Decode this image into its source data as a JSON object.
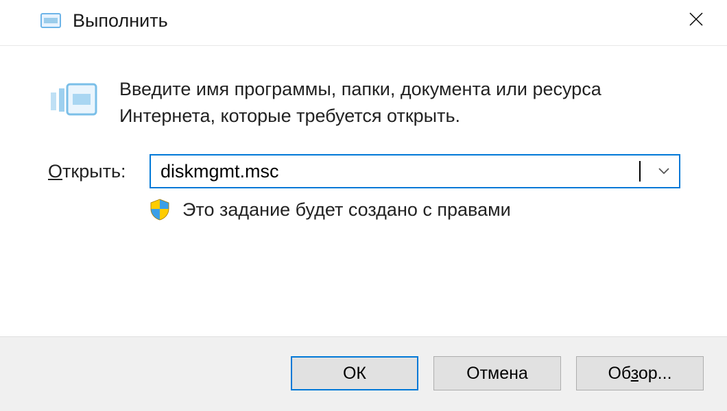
{
  "title": "Выполнить",
  "prompt": "Введите имя программы, папки, документа или ресурса Интернета, которые требуется открыть.",
  "input": {
    "label_pre": "",
    "label_accel": "О",
    "label_post": "ткрыть:",
    "value": "diskmgmt.msc"
  },
  "admin_note": "Это задание будет создано с правами",
  "buttons": {
    "ok": "ОК",
    "cancel": "Отмена",
    "browse_pre": "Об",
    "browse_accel": "з",
    "browse_post": "ор..."
  }
}
